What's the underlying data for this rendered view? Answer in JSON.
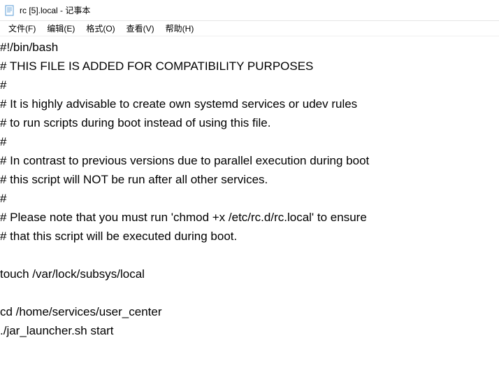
{
  "window": {
    "title": "rc [5].local - 记事本",
    "icon": "notepad-icon"
  },
  "menubar": {
    "items": [
      {
        "label": "文件(F)"
      },
      {
        "label": "编辑(E)"
      },
      {
        "label": "格式(O)"
      },
      {
        "label": "查看(V)"
      },
      {
        "label": "帮助(H)"
      }
    ]
  },
  "editor": {
    "content": "#!/bin/bash\n# THIS FILE IS ADDED FOR COMPATIBILITY PURPOSES\n#\n# It is highly advisable to create own systemd services or udev rules\n# to run scripts during boot instead of using this file.\n#\n# In contrast to previous versions due to parallel execution during boot\n# this script will NOT be run after all other services.\n#\n# Please note that you must run 'chmod +x /etc/rc.d/rc.local' to ensure\n# that this script will be executed during boot.\n\ntouch /var/lock/subsys/local\n\ncd /home/services/user_center\n./jar_launcher.sh start"
  }
}
